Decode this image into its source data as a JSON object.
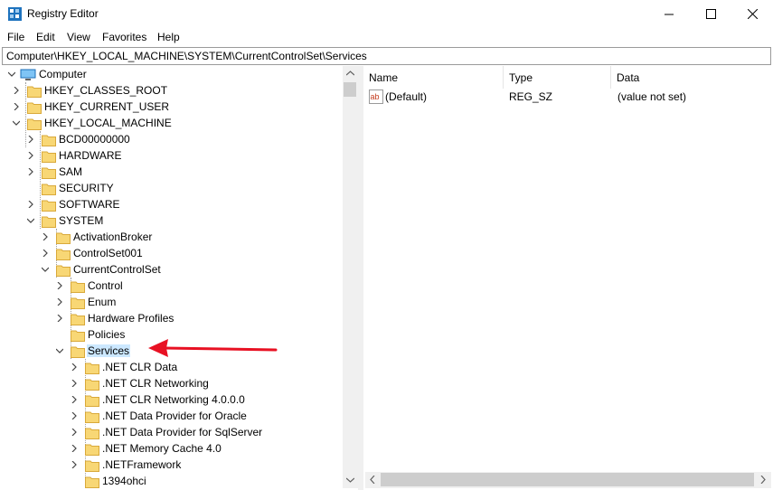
{
  "window": {
    "title": "Registry Editor"
  },
  "menu": [
    "File",
    "Edit",
    "View",
    "Favorites",
    "Help"
  ],
  "address": "Computer\\HKEY_LOCAL_MACHINE\\SYSTEM\\CurrentControlSet\\Services",
  "tree": {
    "root": "Computer",
    "nodes": [
      {
        "label": "HKEY_CLASSES_ROOT",
        "state": "collapsed"
      },
      {
        "label": "HKEY_CURRENT_USER",
        "state": "collapsed"
      },
      {
        "label": "HKEY_LOCAL_MACHINE",
        "state": "expanded"
      },
      {
        "label": "BCD00000000",
        "state": "collapsed"
      },
      {
        "label": "HARDWARE",
        "state": "collapsed"
      },
      {
        "label": "SAM",
        "state": "collapsed"
      },
      {
        "label": "SECURITY",
        "state": "leaf"
      },
      {
        "label": "SOFTWARE",
        "state": "collapsed"
      },
      {
        "label": "SYSTEM",
        "state": "expanded"
      },
      {
        "label": "ActivationBroker",
        "state": "collapsed"
      },
      {
        "label": "ControlSet001",
        "state": "collapsed"
      },
      {
        "label": "CurrentControlSet",
        "state": "expanded"
      },
      {
        "label": "Control",
        "state": "collapsed"
      },
      {
        "label": "Enum",
        "state": "collapsed"
      },
      {
        "label": "Hardware Profiles",
        "state": "collapsed"
      },
      {
        "label": "Policies",
        "state": "leaf"
      },
      {
        "label": "Services",
        "state": "expanded",
        "selected": true
      },
      {
        "label": ".NET CLR Data",
        "state": "collapsed"
      },
      {
        "label": ".NET CLR Networking",
        "state": "collapsed"
      },
      {
        "label": ".NET CLR Networking 4.0.0.0",
        "state": "collapsed"
      },
      {
        "label": ".NET Data Provider for Oracle",
        "state": "collapsed"
      },
      {
        "label": ".NET Data Provider for SqlServer",
        "state": "collapsed"
      },
      {
        "label": ".NET Memory Cache 4.0",
        "state": "collapsed"
      },
      {
        "label": ".NETFramework",
        "state": "collapsed"
      },
      {
        "label": "1394ohci",
        "state": "leaf"
      }
    ]
  },
  "list": {
    "columns": [
      "Name",
      "Type",
      "Data"
    ],
    "rows": [
      {
        "name": "(Default)",
        "type": "REG_SZ",
        "data": "(value not set)",
        "icon": "string-value-icon"
      }
    ]
  },
  "colors": {
    "selection": "#cce8ff",
    "arrow": "#e81123",
    "folder": "#f8d775"
  }
}
